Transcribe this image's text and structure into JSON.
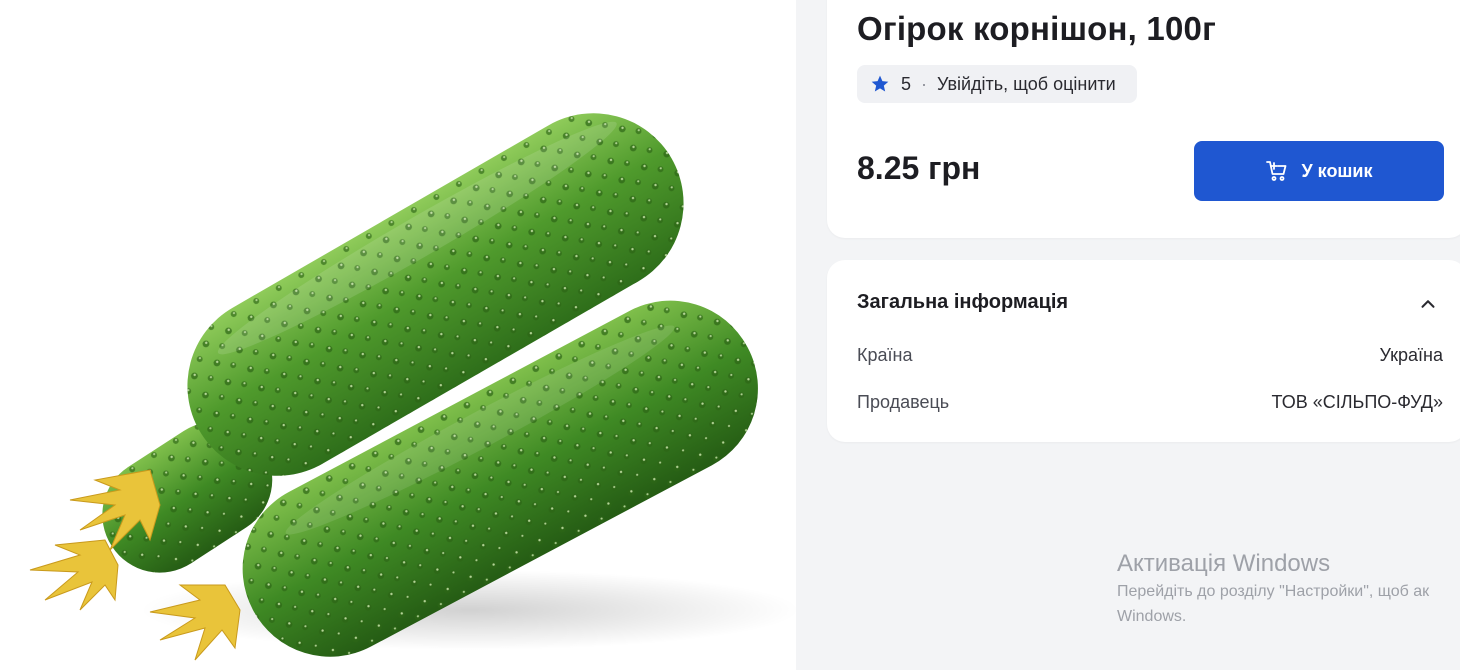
{
  "product": {
    "title": "Огірок корнішон, 100г",
    "rating": {
      "value": "5",
      "separator": "·",
      "prompt": "Увійдіть, щоб оцінити",
      "icon": "star-icon"
    },
    "price": "8.25 грн",
    "cart_button": {
      "label": "У кошик",
      "icon": "cart-add-icon"
    },
    "image": {
      "subject": "cucumbers"
    }
  },
  "general_info": {
    "title": "Загальна інформація",
    "toggle_icon": "chevron-up-icon",
    "rows": [
      {
        "label": "Країна",
        "value": "Україна"
      },
      {
        "label": "Продавець",
        "value": "ТОВ «СІЛЬПО-ФУД»"
      }
    ]
  },
  "watermark": {
    "title": "Активація Windows",
    "line1": "Перейдіть до розділу \"Настройки\", щоб ак",
    "line2": "Windows."
  },
  "colors": {
    "accent": "#1f57d1",
    "star": "#1f57d1",
    "page_bg": "#f3f4f6",
    "card_bg": "#ffffff"
  }
}
